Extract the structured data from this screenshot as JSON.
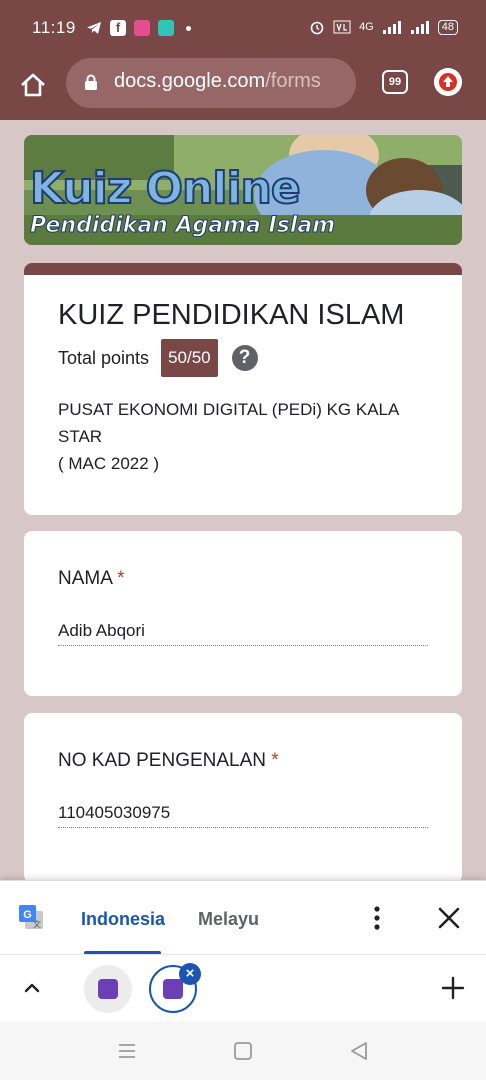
{
  "status_bar": {
    "time": "11:19",
    "network": "4G",
    "battery": "48"
  },
  "browser": {
    "url_main": "docs.google.com",
    "url_rest": "/forms",
    "tab_count": "99"
  },
  "banner": {
    "title": "Kuiz Online",
    "subtitle": "Pendidikan Agama Islam"
  },
  "form": {
    "title": "KUIZ PENDIDIKAN ISLAM",
    "points_label": "Total points",
    "points_value": "50/50",
    "description_line1": "PUSAT EKONOMI DIGITAL (PEDi) KG KALA",
    "description_line2": "STAR",
    "description_line3": "( MAC 2022 )"
  },
  "questions": [
    {
      "label": "NAMA",
      "required_mark": "*",
      "answer": "Adib Abqori"
    },
    {
      "label": "NO KAD PENGENALAN",
      "required_mark": "*",
      "answer": "110405030975"
    }
  ],
  "translate": {
    "active_language": "Indonesia",
    "other_language": "Melayu"
  },
  "icons": {
    "home": "home-icon",
    "lock": "lock-icon",
    "update": "update-icon",
    "help": "help-icon",
    "translate": "google-translate-icon",
    "more": "more-vert-icon",
    "close": "close-icon",
    "chevron": "chevron-up-icon",
    "add": "add-icon",
    "nav_recents": "recents-icon",
    "nav_home": "nav-home-icon",
    "nav_back": "back-icon"
  },
  "colors": {
    "theme": "#7a4747",
    "page_bg": "#d7c7c6",
    "accent_blue": "#1a56b0",
    "required": "#d93025"
  }
}
